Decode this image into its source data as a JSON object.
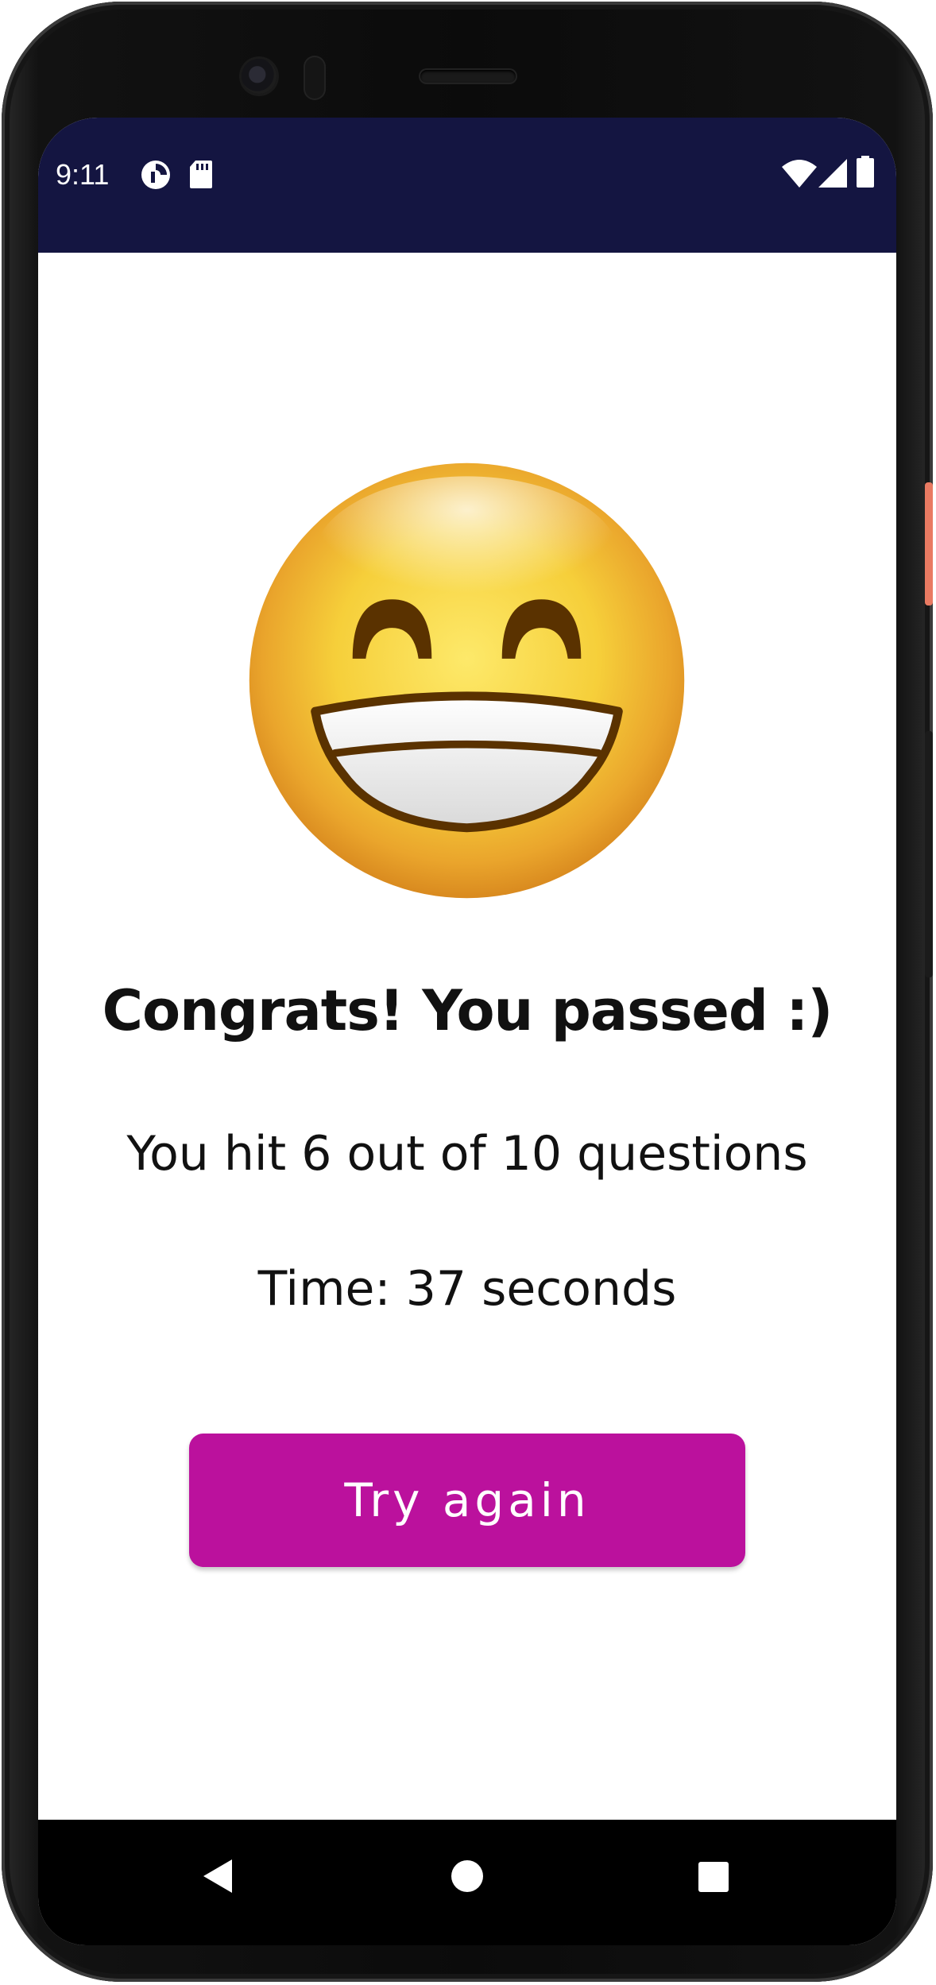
{
  "status_bar": {
    "time": "9:11",
    "icons": [
      "data-saver-icon",
      "sd-card-icon",
      "wifi-icon",
      "cell-signal-icon",
      "battery-icon"
    ],
    "color": "#141541"
  },
  "result": {
    "emoji": "grinning-face-with-smiling-eyes",
    "title": "Congrats! You passed :)",
    "score_text": "You hit 6 out of 10 questions",
    "time_text": "Time: 37 seconds"
  },
  "actions": {
    "try_again_label": "Try again",
    "accent_color": "#bb119d"
  },
  "nav_bar": {
    "icons": [
      "back-icon",
      "home-icon",
      "recents-icon"
    ]
  }
}
